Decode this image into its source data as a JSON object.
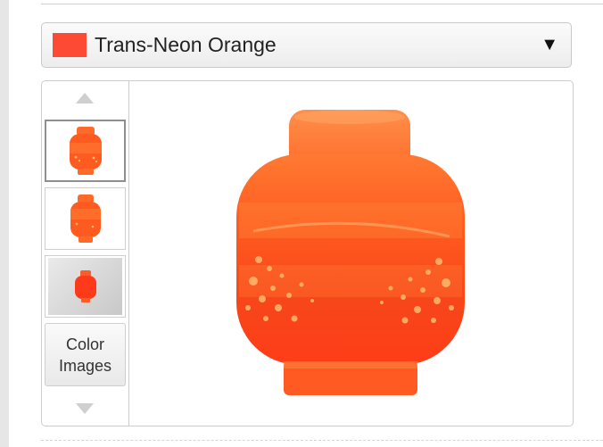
{
  "color_select": {
    "label": "Trans-Neon Orange",
    "swatch_color": "#fc4a34",
    "arrow": "▼"
  },
  "gallery": {
    "nav_up_icon": "triangle-up-icon",
    "nav_down_icon": "triangle-down-icon",
    "thumbnails": [
      {
        "name": "thumb-front",
        "active": true
      },
      {
        "name": "thumb-angle",
        "active": false
      },
      {
        "name": "thumb-photo",
        "active": false
      }
    ],
    "color_images_label": "Color Images",
    "main_image": "minifigure-head-trans-neon-orange"
  },
  "colors": {
    "part_orange": "#ff5a1f",
    "part_light": "#ff8a3d",
    "part_dark": "#f03a12",
    "speckle": "#ffb36b"
  }
}
